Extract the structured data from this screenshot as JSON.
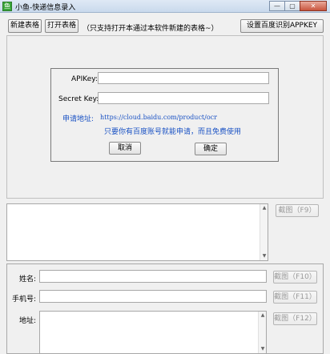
{
  "window": {
    "title": "小鱼-快递信息录入",
    "app_icon_glyph": "鱼",
    "minimize_glyph": "—",
    "restore_glyph": "▢",
    "close_glyph": "✕"
  },
  "toolbar": {
    "new_table": "新建表格",
    "open_table": "打开表格",
    "note": "（只支持打开本通过本软件新建的表格~）",
    "set_apikey": "设置百度识别APPKEY"
  },
  "api_dialog": {
    "apikey_label": "APIKey:",
    "apikey_value": "",
    "secret_label": "Secret Key:",
    "secret_value": "",
    "apply_label": "申请地址:",
    "apply_url": "https://cloud.baidu.com/product/ocr",
    "hint": "只要你有百度账号就能申请，而且免费使用",
    "cancel": "取消",
    "confirm": "确定"
  },
  "ocr": {
    "text": "",
    "screenshot_button": "截图（F9）"
  },
  "form": {
    "name_label": "姓名:",
    "name_value": "",
    "name_button": "截图（F10）",
    "phone_label": "手机号:",
    "phone_value": "",
    "phone_button": "截图（F11）",
    "address_label": "地址:",
    "address_value": "",
    "address_button": "截图（F12）"
  },
  "icons": {
    "scroll_up": "▲",
    "scroll_down": "▼"
  },
  "colors": {
    "link": "#1a52c4",
    "window_bg": "#f0f0f0",
    "close_button": "#c8553e"
  }
}
